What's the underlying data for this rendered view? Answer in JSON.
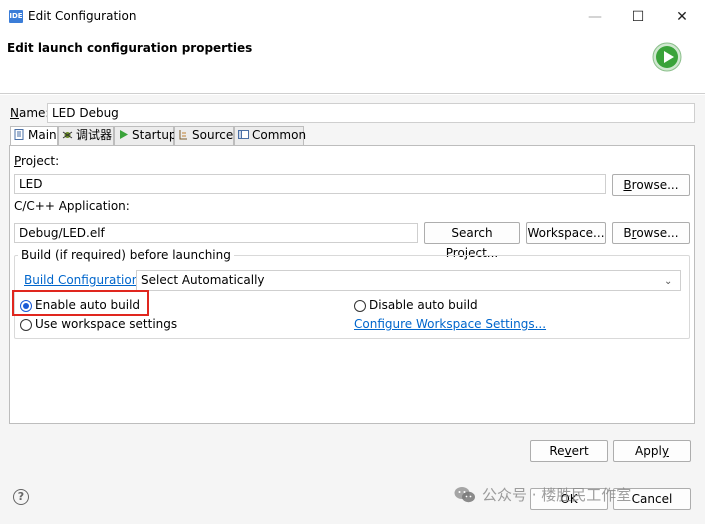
{
  "window": {
    "icon_text": "IDE",
    "title": "Edit Configuration",
    "minimize": "—",
    "maximize": "☐",
    "close": "✕"
  },
  "banner": {
    "title": "Edit launch configuration properties",
    "icon": "run-icon"
  },
  "name": {
    "label": "Name:",
    "value": "LED Debug"
  },
  "tabs": [
    {
      "label": "Main",
      "icon": "main-tab-icon",
      "active": true
    },
    {
      "label": "调试器",
      "icon": "debugger-tab-icon",
      "active": false
    },
    {
      "label": "Startup",
      "icon": "startup-tab-icon",
      "active": false
    },
    {
      "label": "Source",
      "icon": "source-tab-icon",
      "active": false
    },
    {
      "label": "Common",
      "icon": "common-tab-icon",
      "active": false
    }
  ],
  "project": {
    "label": "Project:",
    "value": "LED",
    "browse_label": "Browse..."
  },
  "application": {
    "label": "C/C++ Application:",
    "value": "Debug/LED.elf",
    "search_project_label": "Search Project...",
    "workspace_label": "Workspace...",
    "browse_label": "Browse..."
  },
  "build": {
    "group_label": "Build (if required) before launching",
    "config_link": "Build Configuration:",
    "config_value": "Select Automatically",
    "enable_label": "Enable auto build",
    "enable_selected": true,
    "disable_label": "Disable auto build",
    "workspace_label": "Use workspace settings",
    "configure_link": "Configure Workspace Settings..."
  },
  "footer": {
    "revert_label": "Revert",
    "apply_label": "Apply",
    "help": "?",
    "ok_label": "OK",
    "cancel_label": "Cancel"
  },
  "watermark": {
    "text": "公众号 · 楼胜民工作室"
  },
  "colors": {
    "accent": "#1a5bd6",
    "link": "#0066cc",
    "highlight": "#e0261e",
    "run_icon": "#3aa33a"
  }
}
